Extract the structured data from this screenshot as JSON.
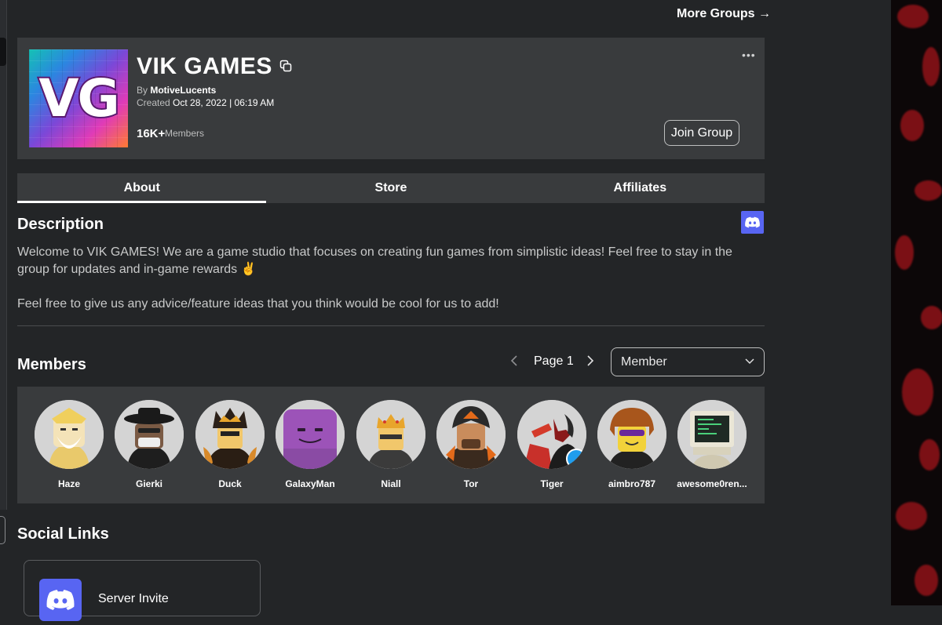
{
  "nav": {
    "more_groups": "More Groups →"
  },
  "group": {
    "logo_text": "VG",
    "name": "VIK GAMES",
    "by_label": "By ",
    "owner": "MotiveLucents",
    "created_label": "Created ",
    "created_date": "Oct 28, 2022 | 06:19 AM",
    "member_count": "16K+",
    "member_count_label": "Members",
    "more_options": "•••",
    "join_button": "Join Group"
  },
  "tabs": [
    {
      "label": "About",
      "active": true
    },
    {
      "label": "Store",
      "active": false
    },
    {
      "label": "Affiliates",
      "active": false
    }
  ],
  "description": {
    "title": "Description",
    "paragraph_1": "Welcome to VIK GAMES! We are a game studio that focuses on creating fun games from simplistic ideas! Feel free to stay in the group for updates and in-game rewards ✌️",
    "paragraph_2": "Feel free to give us any advice/feature ideas that you think would be cool for us to add!"
  },
  "members": {
    "title": "Members",
    "page_label": "Page 1",
    "role_filter": "Member",
    "list": [
      {
        "name": "Haze"
      },
      {
        "name": "Gierki"
      },
      {
        "name": "Duck"
      },
      {
        "name": "GalaxyMan"
      },
      {
        "name": "Niall"
      },
      {
        "name": "Tor"
      },
      {
        "name": "Tiger"
      },
      {
        "name": "aimbro787"
      },
      {
        "name": "awesome0ren..."
      }
    ]
  },
  "social": {
    "title": "Social Links",
    "links": [
      {
        "label": "Server Invite",
        "icon": "discord-icon"
      }
    ]
  },
  "colors": {
    "background": "#232527",
    "card": "#393b3d",
    "discord": "#5865f2"
  }
}
